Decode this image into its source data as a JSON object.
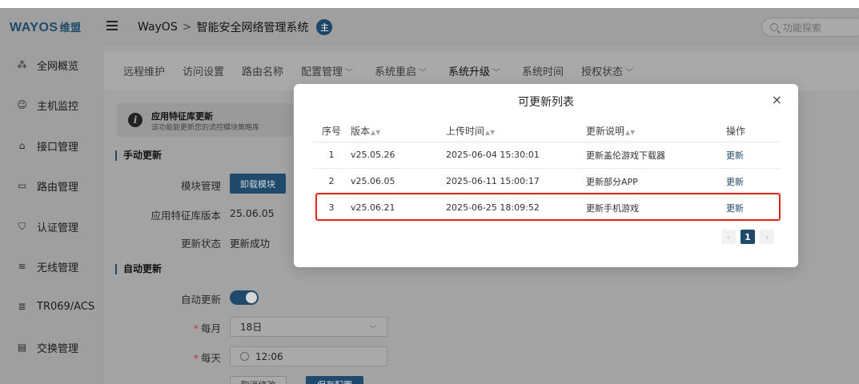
{
  "header": {
    "logo": "WAYOS",
    "logo_cn": "维盟",
    "breadcrumb_root": "WayOS",
    "breadcrumb_sep": ">",
    "breadcrumb_current": "智能安全网络管理系统",
    "badge": "主",
    "search_placeholder": "功能探索"
  },
  "sidebar": {
    "items": [
      {
        "label": "全网概览",
        "icon": "network-tree-icon",
        "glyph": "⁂"
      },
      {
        "label": "主机监控",
        "icon": "user-circle-icon",
        "glyph": "☺"
      },
      {
        "label": "接口管理",
        "icon": "home-icon",
        "glyph": "⌂"
      },
      {
        "label": "路由管理",
        "icon": "router-icon",
        "glyph": "▭"
      },
      {
        "label": "认证管理",
        "icon": "shield-icon",
        "glyph": "⛉"
      },
      {
        "label": "无线管理",
        "icon": "wifi-icon",
        "glyph": "≋"
      },
      {
        "label": "TR069/ACS",
        "icon": "server-icon",
        "glyph": "≣"
      },
      {
        "label": "交换管理",
        "icon": "switch-icon",
        "glyph": "▤"
      }
    ]
  },
  "tabs": [
    {
      "label": "远程维护",
      "dropdown": false
    },
    {
      "label": "访问设置",
      "dropdown": false
    },
    {
      "label": "路由名称",
      "dropdown": false
    },
    {
      "label": "配置管理",
      "dropdown": true
    },
    {
      "label": "系统重启",
      "dropdown": true
    },
    {
      "label": "系统升级",
      "dropdown": true,
      "active": true
    },
    {
      "label": "系统时间",
      "dropdown": false
    },
    {
      "label": "授权状态",
      "dropdown": true
    }
  ],
  "notice": {
    "title": "应用特征库更新",
    "desc": "该功能能更新您的流控模块策略库"
  },
  "manual": {
    "title": "手动更新",
    "module_label": "模块管理",
    "unload_button": "卸载模块",
    "version_label": "应用特征库版本",
    "version_value": "25.06.05",
    "status_label": "更新状态",
    "status_value": "更新成功"
  },
  "auto": {
    "title": "自动更新",
    "toggle_label": "自动更新",
    "toggle_on": true,
    "monthly_label": "每月",
    "monthly_value": "18日",
    "daily_label": "每天",
    "daily_value": "12:06",
    "cancel_button": "取消修改",
    "save_button": "保存配置"
  },
  "modal": {
    "title": "可更新列表",
    "close": "×",
    "columns": [
      "序号",
      "版本",
      "上传时间",
      "更新说明",
      "操作"
    ],
    "rows": [
      {
        "no": "1",
        "version": "v25.05.26",
        "time": "2025-06-04 15:30:01",
        "desc": "更新盖伦游戏下载器",
        "action": "更新"
      },
      {
        "no": "2",
        "version": "v25.06.05",
        "time": "2025-06-11 15:00:17",
        "desc": "更新部分APP",
        "action": "更新"
      },
      {
        "no": "3",
        "version": "v25.06.21",
        "time": "2025-06-25 18:09:52",
        "desc": "更新手机游戏",
        "action": "更新"
      }
    ],
    "highlighted_row": 3,
    "highlight_color": "#e1261c",
    "pager": {
      "prev": "‹",
      "current": "1",
      "next": "›"
    }
  },
  "colors": {
    "accent": "#1f4a6b",
    "overlay": "#9f9f9f"
  }
}
